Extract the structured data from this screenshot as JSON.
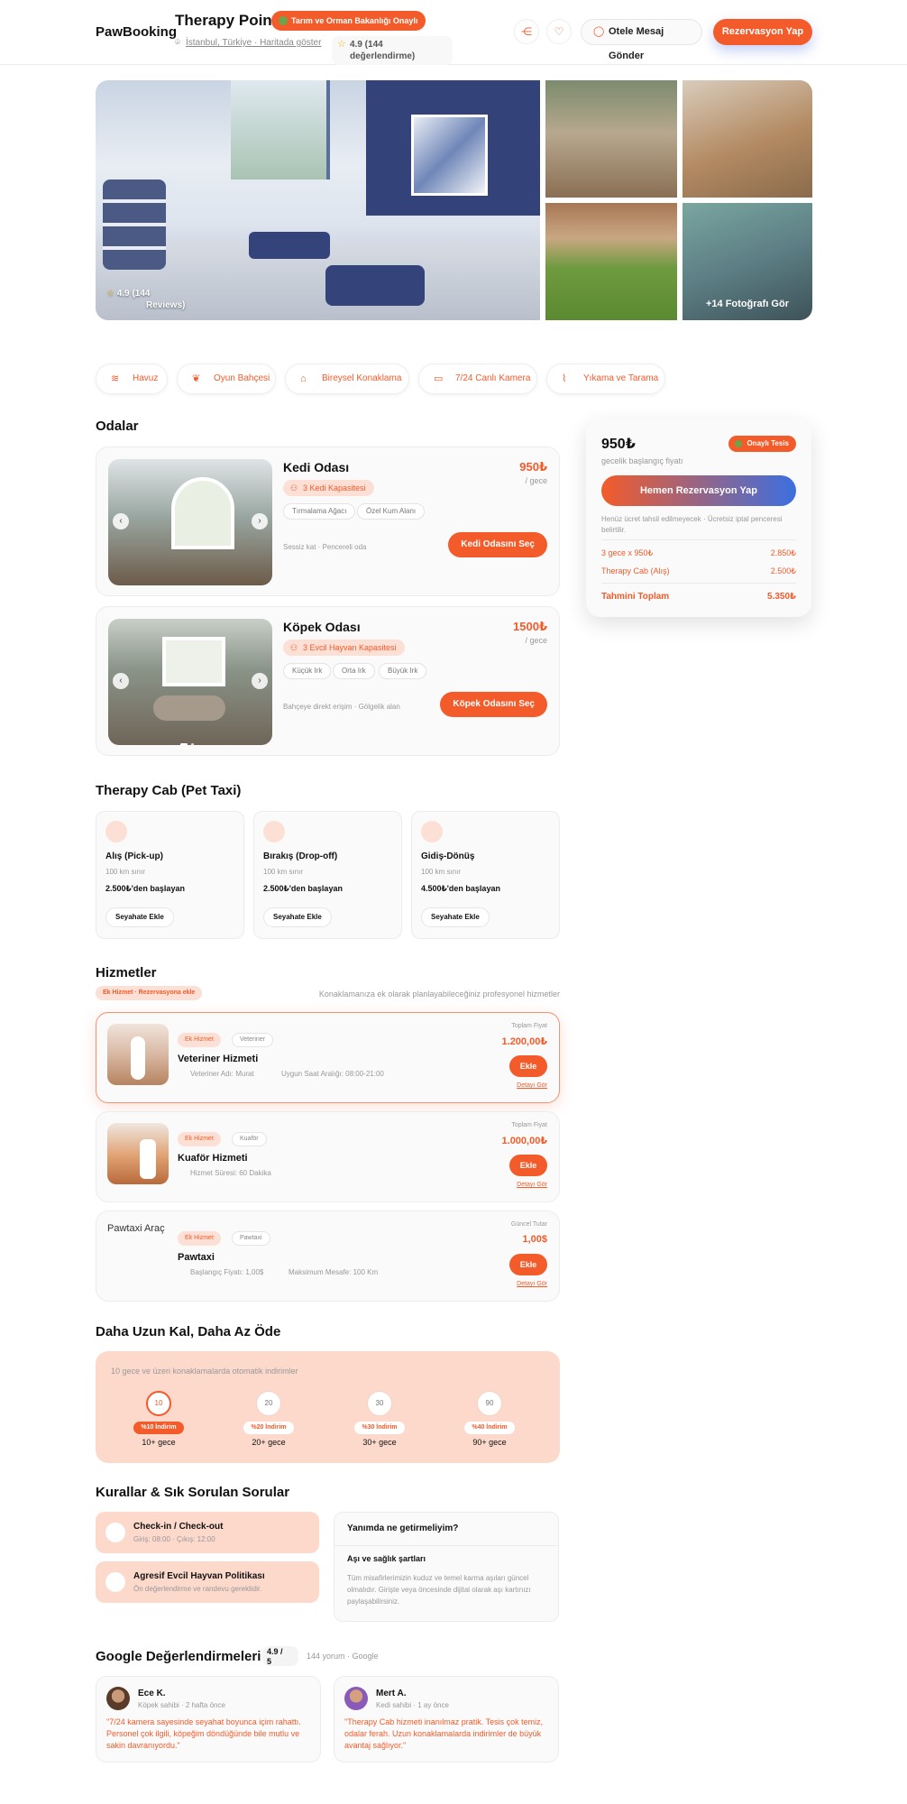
{
  "header": {
    "brand": "PawBooking",
    "hotel_name": "Therapy Point",
    "approved_badge": "Tarım ve Orman Bakanlığı Onaylı",
    "location": "İstanbul, Türkiye · Haritada göster",
    "rating_line1": "4.9 (144",
    "rating_line2": "değerlendirme)",
    "message_button": "Otele Mesaj Gönder",
    "reserve_button": "Rezervasyon Yap"
  },
  "gallery": {
    "rating": "4.9",
    "reviews_line1": "(144",
    "reviews_line2": "Reviews)",
    "more_photos": "+14 Fotoğrafı Gör"
  },
  "amenities": [
    {
      "label": "Havuz",
      "icon": "waves-icon"
    },
    {
      "label": "Oyun Bahçesi",
      "icon": "paw-icon"
    },
    {
      "label": "Bireysel Konaklama",
      "icon": "home-icon"
    },
    {
      "label": "7/24 Canlı Kamera",
      "icon": "camera-icon"
    },
    {
      "label": "Yıkama ve Tarama",
      "icon": "brush-icon"
    }
  ],
  "rooms": {
    "title": "Odalar",
    "items": [
      {
        "name": "Kedi Odası",
        "capacity": "3 Kedi Kapasitesi",
        "features": [
          "Tırmalama Ağacı",
          "Özel Kum Alanı"
        ],
        "note": "Sessiz kat · Pencereli oda",
        "price": "950₺",
        "per": "/ gece",
        "button": "Kedi Odasını Seç"
      },
      {
        "name": "Köpek Odası",
        "capacity": "3 Evcil Hayvan Kapasitesi",
        "features": [
          "Küçük Irk",
          "Orta Irk",
          "Büyük Irk"
        ],
        "note": "Bahçeye direkt erişim · Gölgelik alan",
        "price": "1500₺",
        "per": "/ gece",
        "button": "Köpek Odasını Seç"
      }
    ]
  },
  "booking": {
    "price": "950₺",
    "sub": "gecelik başlangıç fiyatı",
    "badge": "Onaylı Tesis",
    "button": "Hemen Rezervasyon Yap",
    "info": "Henüz ücret tahsil edilmeyecek · Ücretsiz iptal penceresi belirtilir.",
    "line1_label": "3 gece x 950₺",
    "line1_value": "2.850₺",
    "line2_label": "Therapy Cab (Alış)",
    "line2_value": "2.500₺",
    "total_label": "Tahmini Toplam",
    "total_value": "5.350₺"
  },
  "cab": {
    "title": "Therapy Cab (Pet Taxi)",
    "items": [
      {
        "title": "Alış (Pick-up)",
        "limit": "100 km sınır",
        "price": "2.500₺'den başlayan",
        "button": "Seyahate Ekle"
      },
      {
        "title": "Bırakış (Drop-off)",
        "limit": "100 km sınır",
        "price": "2.500₺'den başlayan",
        "button": "Seyahate Ekle"
      },
      {
        "title": "Gidiş-Dönüş",
        "limit": "100 km sınır",
        "price": "4.500₺'den başlayan",
        "button": "Seyahate Ekle"
      }
    ]
  },
  "services": {
    "title": "Hizmetler",
    "tag": "Ek Hizmet · Rezervasyona ekle",
    "description": "Konaklamanıza ek olarak planlayabileceğiniz profesyonel hizmetler",
    "items": [
      {
        "chip1": "Ek Hizmet",
        "chip2": "Veteriner",
        "name": "Veteriner Hizmeti",
        "meta1": "Veteriner Adı: Murat",
        "meta2": "Uygun Saat Aralığı: 08:00-21:00",
        "price_label": "Toplam Fiyat",
        "price": "1.200,00₺",
        "button": "Ekle",
        "details": "Detayı Gör"
      },
      {
        "chip1": "Ek Hizmet",
        "chip2": "Kuaför",
        "name": "Kuaför Hizmeti",
        "meta1": "Hizmet Süresi: 60 Dakika",
        "meta2": "",
        "price_label": "Toplam Fiyat",
        "price": "1.000,00₺",
        "button": "Ekle",
        "details": "Detayı Gör"
      },
      {
        "alt": "Pawtaxi Araç",
        "chip1": "Ek Hizmet",
        "chip2": "Pawtaxi",
        "name": "Pawtaxi",
        "meta1": "Başlangıç Fiyatı: 1,00$",
        "meta2": "Maksimum Mesafe: 100 Km",
        "price_label": "Güncel Tutar",
        "price": "1,00$",
        "button": "Ekle",
        "details": "Detayı Gör"
      }
    ]
  },
  "long_stay": {
    "title": "Daha Uzun Kal, Daha Az Öde",
    "info": "10 gece ve üzeri konaklamalarda otomatik indirimler",
    "tiers": [
      {
        "nights": "10",
        "discount": "%10 İndirim",
        "label": "10+ gece"
      },
      {
        "nights": "20",
        "discount": "%20 İndirim",
        "label": "20+ gece"
      },
      {
        "nights": "30",
        "discount": "%30 İndirim",
        "label": "30+ gece"
      },
      {
        "nights": "90",
        "discount": "%40 İndirim",
        "label": "90+ gece"
      }
    ]
  },
  "faq": {
    "title": "Kurallar & Sık Sorulan Sorular",
    "items": [
      {
        "q": "Check-in / Check-out",
        "a": "Giriş: 08:00 · Çıkış: 12:00"
      },
      {
        "q": "Agresif Evcil Hayvan Politikası",
        "a": "Ön değerlendirme ve randevu gereklidir."
      }
    ],
    "panel_q1": "Yanımda ne getirmeliyim?",
    "panel_q2": "Aşı ve sağlık şartları",
    "panel_text": "Tüm misafirlerimizin kuduz ve temel karma aşıları güncel olmalıdır. Girişte veya öncesinde dijital olarak aşı kartınızı paylaşabilirsiniz."
  },
  "google": {
    "title": "Google Değerlendirmeleri",
    "score_line1": "4.9 /",
    "score_line2": "5",
    "count": "144 yorum · Google",
    "reviews": [
      {
        "name": "Ece K.",
        "meta": "Köpek sahibi · 2 hafta önce",
        "text": "\"7/24 kamera sayesinde seyahat boyunca içim rahattı. Personel çok ilgili, köpeğim döndüğünde bile mutlu ve sakin davranıyordu.\""
      },
      {
        "name": "Mert A.",
        "meta": "Kedi sahibi · 1 ay önce",
        "text": "\"Therapy Cab hizmeti inanılmaz pratik. Tesis çok temiz, odalar ferah. Uzun konaklamalarda indirimler de büyük avantaj sağlıyor.\""
      }
    ]
  },
  "colors": {
    "accent": "#f35b2a",
    "accent_light": "#fde0d5",
    "blue": "#3b6fe0"
  }
}
